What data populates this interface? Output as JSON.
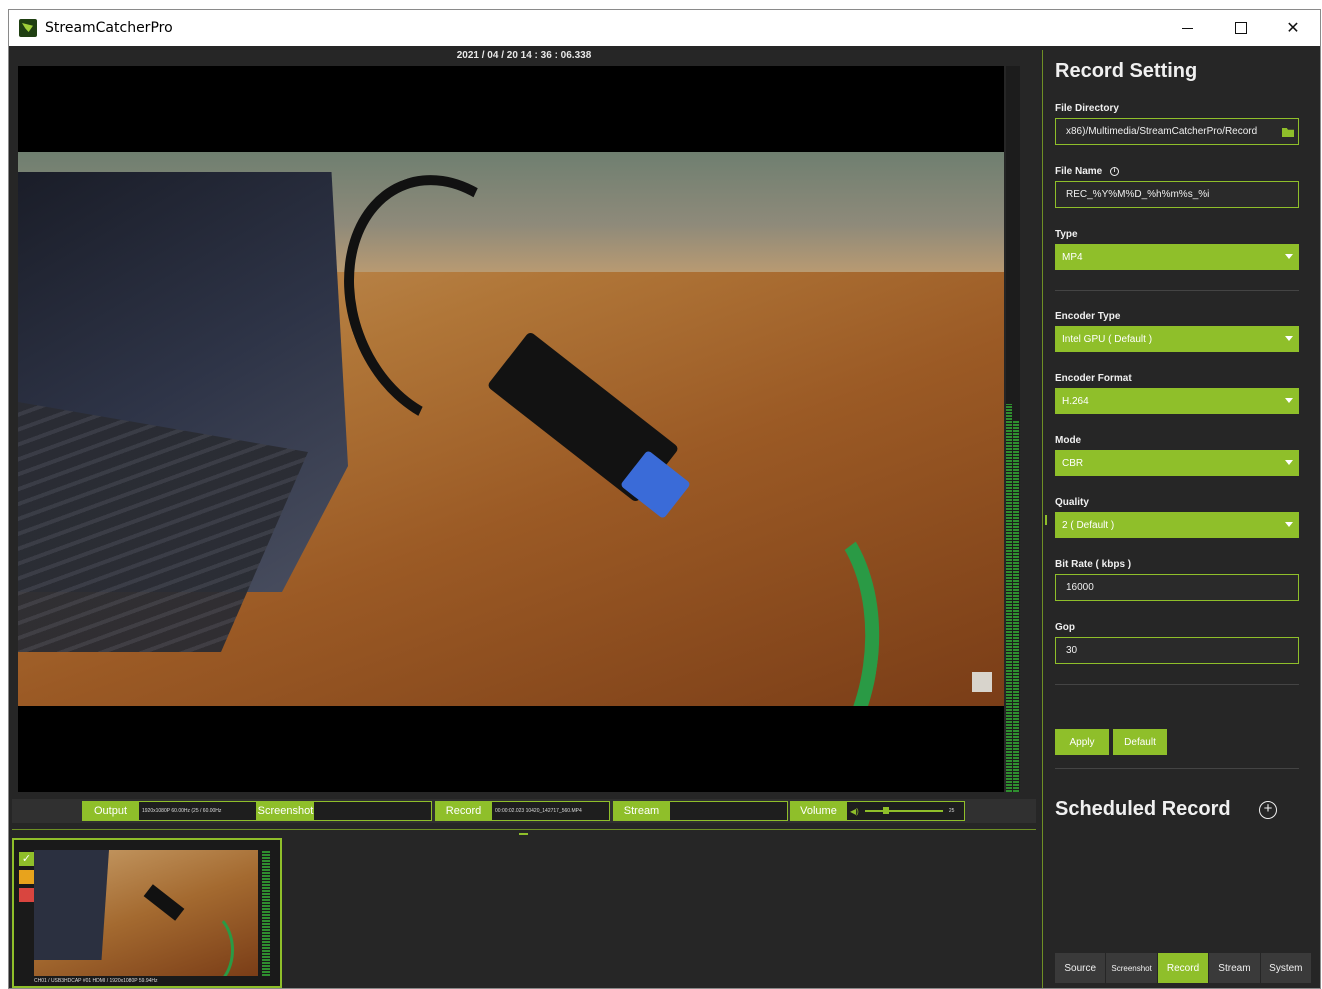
{
  "window": {
    "title": "StreamCatcherPro",
    "minimize": "—",
    "close": "✕"
  },
  "preview": {
    "timestamp": "2021 / 04 / 20   14 : 36 : 06.338"
  },
  "controls": {
    "output_label": "Output",
    "output_info": "1920x1080P 60.00Hz   (25 / 60.00Hz",
    "screenshot_label": "Screenshot",
    "screenshot_info": "",
    "record_label": "Record",
    "record_info": "00:00:02.023  10420_142717_560.MP4",
    "stream_label": "Stream",
    "stream_info": "",
    "volume_label": "Volume",
    "volume_value": "25",
    "volume_level": 0.25
  },
  "thumbnail": {
    "caption": "CH01 / USB3HDCAP #01 HDMI / 1920x1080P 59.94Hz",
    "check": "✓"
  },
  "record_setting": {
    "title": "Record Setting",
    "file_directory_label": "File Directory",
    "file_directory_value": "x86)/Multimedia/StreamCatcherPro/Record",
    "file_name_label": "File Name",
    "info_glyph": "i",
    "file_name_value": "REC_%Y%M%D_%h%m%s_%i",
    "type_label": "Type",
    "type_value": "MP4",
    "encoder_type_label": "Encoder Type",
    "encoder_type_value": "Intel GPU ( Default )",
    "encoder_format_label": "Encoder Format",
    "encoder_format_value": "H.264",
    "mode_label": "Mode",
    "mode_value": "CBR",
    "quality_label": "Quality",
    "quality_value": "2 ( Default )",
    "bitrate_label": "Bit Rate ( kbps )",
    "bitrate_value": "16000",
    "gop_label": "Gop",
    "gop_value": "30",
    "apply_label": "Apply",
    "default_label": "Default"
  },
  "scheduled_record": {
    "title": "Scheduled Record",
    "add_glyph": "+"
  },
  "tabs": [
    {
      "label": "Source"
    },
    {
      "label": "Screenshot"
    },
    {
      "label": "Record"
    },
    {
      "label": "Stream"
    },
    {
      "label": "System"
    }
  ],
  "colors": {
    "accent": "#8fbf2a",
    "background": "#262626",
    "recording_yellow": "#e8a31c",
    "recording_red": "#d9453f"
  }
}
